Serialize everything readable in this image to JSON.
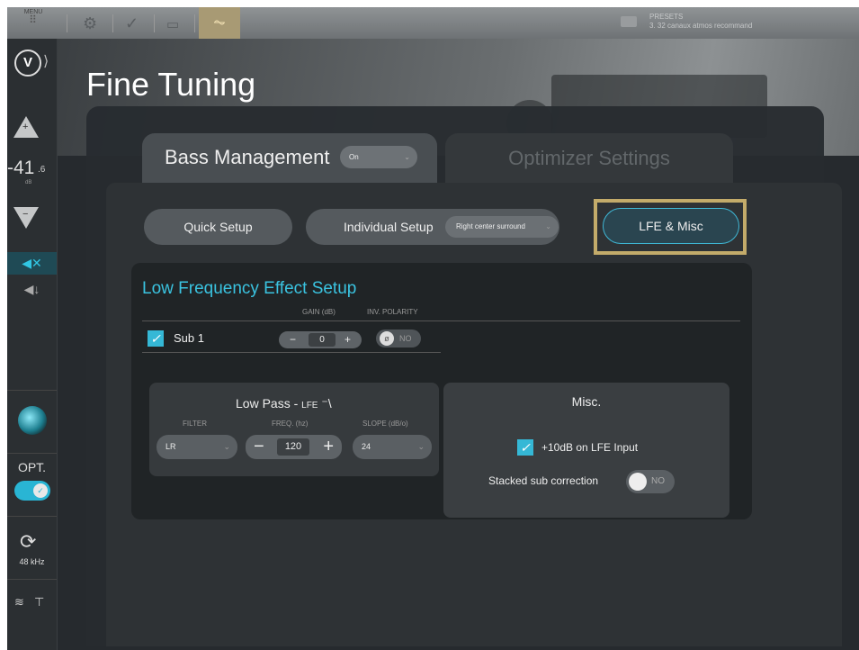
{
  "topbar": {
    "menu_label": "MENU",
    "presets_label": "PRESETS",
    "preset_name": "3. 32 canaux atmos recommand"
  },
  "sidebar": {
    "volume_value": "-41",
    "volume_decimal": ".6",
    "volume_unit": "dB",
    "input_label": "OPT.",
    "sample_rate": "48 kHz"
  },
  "page": {
    "title": "Fine Tuning"
  },
  "tabs": {
    "bass_management": "Bass Management",
    "bass_management_value": "On",
    "optimizer_settings": "Optimizer Settings"
  },
  "setup_buttons": {
    "quick": "Quick Setup",
    "individual": "Individual Setup",
    "individual_channel": "Right center surround",
    "lfe_misc": "LFE & Misc"
  },
  "lfe": {
    "title": "Low Frequency Effect Setup",
    "gain_header": "GAIN (dB)",
    "polarity_header": "INV. POLARITY",
    "sub_label": "Sub 1",
    "gain_value": "0",
    "polarity_value": "NO"
  },
  "low_pass": {
    "title": "Low Pass - ",
    "title_small": "LFE",
    "filter_header": "FILTER",
    "freq_header": "FREQ. (hz)",
    "slope_header": "SLOPE (dB/o)",
    "filter_value": "LR",
    "freq_value": "120",
    "slope_value": "24"
  },
  "misc": {
    "title": "Misc.",
    "lfe_input_label": "+10dB on LFE Input",
    "stacked_label": "Stacked sub correction",
    "stacked_value": "NO"
  },
  "colors": {
    "accent": "#35b8d6",
    "highlight_frame": "#c3ab6a",
    "active_tab": "#a89a74"
  }
}
